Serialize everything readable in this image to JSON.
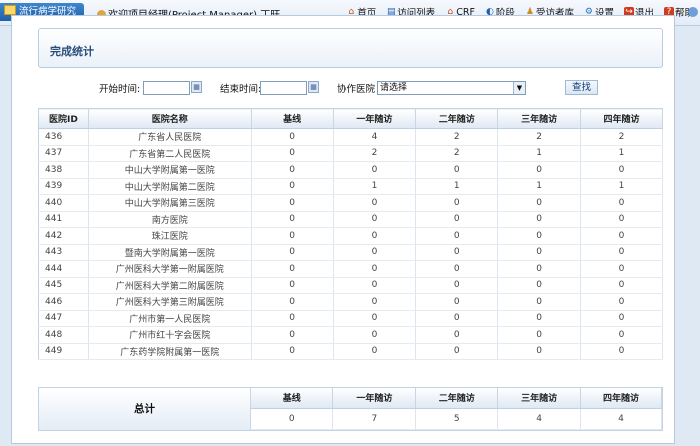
{
  "app": {
    "title": "流行病学研究"
  },
  "user": {
    "welcome": "欢迎项目经理(Project Manager)",
    "name": "丁旺"
  },
  "nav": [
    {
      "label": "首页",
      "icon": "home-icon"
    },
    {
      "label": "访问列表",
      "icon": "list-icon"
    },
    {
      "label": "CRF",
      "icon": "crf-icon"
    },
    {
      "label": "阶段",
      "icon": "stage-icon"
    },
    {
      "label": "受访者库",
      "icon": "subject-library-icon"
    },
    {
      "label": "设置",
      "icon": "settings-icon"
    },
    {
      "label": "退出",
      "icon": "exit-icon"
    },
    {
      "label": "帮助",
      "icon": "help-icon"
    }
  ],
  "page": {
    "title": "完成统计"
  },
  "filters": {
    "start_label": "开始时间:",
    "end_label": "结束时间:",
    "hospital_label": "协作医院",
    "hospital_selected": "请选择",
    "search_label": "查找",
    "start_value": "",
    "end_value": ""
  },
  "table": {
    "headers": [
      "医院ID",
      "医院名称",
      "基线",
      "一年随访",
      "二年随访",
      "三年随访",
      "四年随访"
    ],
    "rows": [
      [
        "436",
        "广东省人民医院",
        "0",
        "4",
        "2",
        "2",
        "2"
      ],
      [
        "437",
        "广东省第二人民医院",
        "0",
        "2",
        "2",
        "1",
        "1"
      ],
      [
        "438",
        "中山大学附属第一医院",
        "0",
        "0",
        "0",
        "0",
        "0"
      ],
      [
        "439",
        "中山大学附属第二医院",
        "0",
        "1",
        "1",
        "1",
        "1"
      ],
      [
        "440",
        "中山大学附属第三医院",
        "0",
        "0",
        "0",
        "0",
        "0"
      ],
      [
        "441",
        "南方医院",
        "0",
        "0",
        "0",
        "0",
        "0"
      ],
      [
        "442",
        "珠江医院",
        "0",
        "0",
        "0",
        "0",
        "0"
      ],
      [
        "443",
        "暨南大学附属第一医院",
        "0",
        "0",
        "0",
        "0",
        "0"
      ],
      [
        "444",
        "广州医科大学第一附属医院",
        "0",
        "0",
        "0",
        "0",
        "0"
      ],
      [
        "445",
        "广州医科大学第二附属医院",
        "0",
        "0",
        "0",
        "0",
        "0"
      ],
      [
        "446",
        "广州医科大学第三附属医院",
        "0",
        "0",
        "0",
        "0",
        "0"
      ],
      [
        "447",
        "广州市第一人民医院",
        "0",
        "0",
        "0",
        "0",
        "0"
      ],
      [
        "448",
        "广州市红十字会医院",
        "0",
        "0",
        "0",
        "0",
        "0"
      ],
      [
        "449",
        "广东药学院附属第一医院",
        "0",
        "0",
        "0",
        "0",
        "0"
      ]
    ]
  },
  "summary": {
    "label": "总计",
    "headers": [
      "基线",
      "一年随访",
      "二年随访",
      "三年随访",
      "四年随访"
    ],
    "values": [
      "0",
      "7",
      "5",
      "4",
      "4"
    ]
  }
}
